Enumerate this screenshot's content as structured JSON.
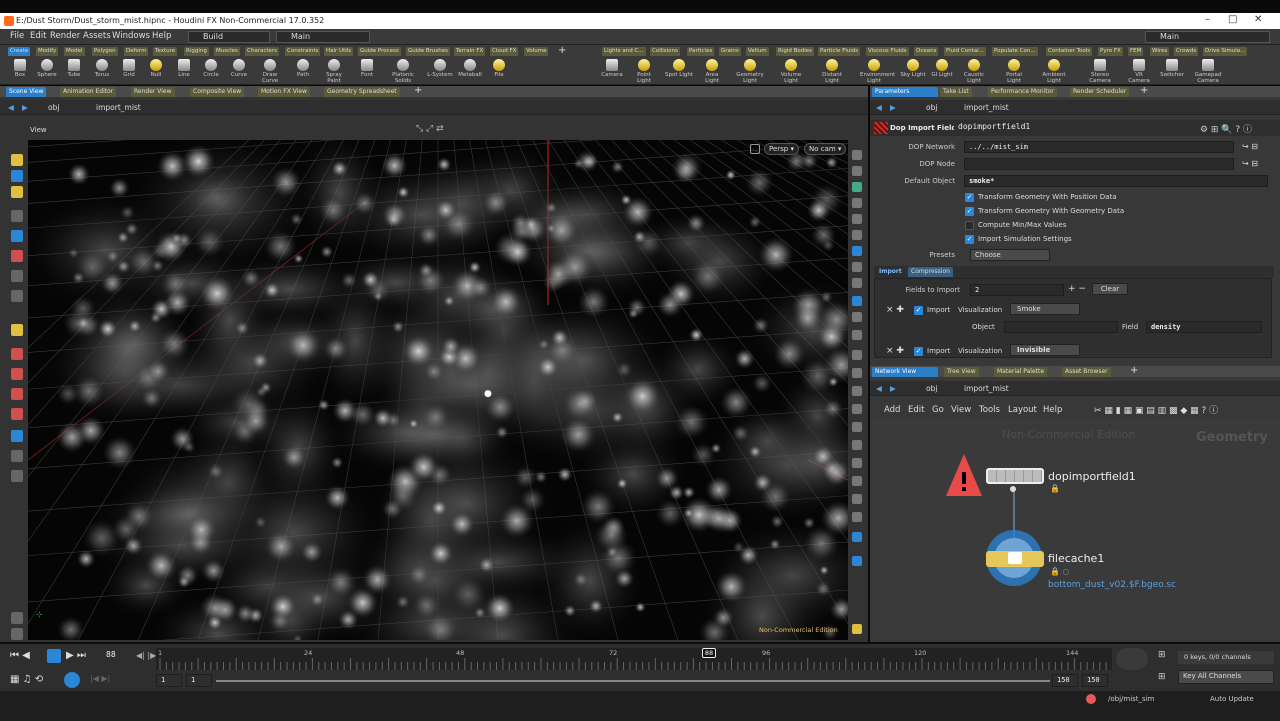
{
  "window": {
    "title": "E:/Dust Storm/Dust_storm_mist.hipnc - Houdini FX Non-Commercial 17.0.352"
  },
  "menu": [
    "File",
    "Edit",
    "Render",
    "Assets",
    "Windows",
    "Help"
  ],
  "desktops": {
    "build": "Build",
    "main": "Main",
    "right_main": "Main"
  },
  "shelf_tabs_left": [
    "Create",
    "Modify",
    "Model",
    "Polygon",
    "Deform",
    "Texture",
    "Rigging",
    "Muscles",
    "Characters",
    "Constraints",
    "Hair Utils",
    "Guide Process",
    "Guide Brushes",
    "Terrain FX",
    "Cloud FX",
    "Volume"
  ],
  "shelf_tabs_right": [
    "Lights and C...",
    "Collisions",
    "Particles",
    "Grains",
    "Vellum",
    "Rigid Bodies",
    "Particle Fluids",
    "Viscous Fluids",
    "Oceans",
    "Fluid Contai...",
    "Populate Con...",
    "Container Tools",
    "Pyro FX",
    "FEM",
    "Wires",
    "Crowds",
    "Drive Simula..."
  ],
  "tools_left": [
    "Box",
    "Sphere",
    "Tube",
    "Torus",
    "Grid",
    "Null",
    "Line",
    "Circle",
    "Curve",
    "Draw Curve",
    "Path",
    "Spray Paint",
    "Font",
    "Platonic Solids",
    "L-System",
    "Metaball",
    "File"
  ],
  "tools_right": [
    "Camera",
    "Point Light",
    "Spot Light",
    "Area Light",
    "Geometry Light",
    "Volume Light",
    "Distant Light",
    "Environment Light",
    "Sky Light",
    "GI Light",
    "Caustic Light",
    "Portal Light",
    "Ambient Light",
    "Stereo Camera",
    "VR Camera",
    "Switcher",
    "Gamepad Camera"
  ],
  "left_pane": {
    "tabs": [
      "Scene View",
      "Animation Editor",
      "Render View",
      "Composite View",
      "Motion FX View",
      "Geometry Spreadsheet"
    ],
    "path": {
      "obj": "obj",
      "node": "import_mist"
    },
    "view_label": "View",
    "persp": "Persp",
    "cam": "No cam",
    "watermark": "Non-Commercial Edition"
  },
  "right_pane": {
    "tabs": [
      "Parameters",
      "Take List",
      "Performance Monitor",
      "Render Scheduler"
    ],
    "path": {
      "obj": "obj",
      "node": "import_mist"
    },
    "node_type": "Dop Import Fields",
    "node_name": "dopimportfield1",
    "params": {
      "dop_network_label": "DOP Network",
      "dop_network": "../../mist_sim",
      "dop_node_label": "DOP Node",
      "dop_node": "",
      "default_object_label": "Default Object",
      "default_object": "smoke*",
      "checks": [
        {
          "label": "Transform Geometry With Position Data",
          "on": true
        },
        {
          "label": "Transform Geometry With Geometry Data",
          "on": true
        },
        {
          "label": "Compute Min/Max Values",
          "on": false
        },
        {
          "label": "Import Simulation Settings",
          "on": true
        }
      ],
      "presets_label": "Presets",
      "presets": "Choose",
      "subtabs": [
        "Import",
        "Compression"
      ],
      "fields_label": "Fields to Import",
      "fields_count": "2",
      "clear": "Clear",
      "row1": {
        "import": "Import",
        "vis_label": "Visualization",
        "vis": "Smoke",
        "object_label": "Object",
        "field_label": "Field",
        "field": "density"
      },
      "row2": {
        "import": "Import",
        "vis_label": "Visualization",
        "vis": "Invisible"
      }
    }
  },
  "network": {
    "tabs": [
      "Network View",
      "Tree View",
      "Material Palette",
      "Asset Browser"
    ],
    "path": {
      "obj": "obj",
      "node": "import_mist"
    },
    "menu": [
      "Add",
      "Edit",
      "Go",
      "View",
      "Tools",
      "Layout",
      "Help"
    ],
    "watermark": "Non-Commercial Edition",
    "context": "Geometry",
    "node1": "dopimportfield1",
    "node2": "filecache1",
    "node2_file": "bottom_dust_v02.$F.bgeo.sc"
  },
  "timeline": {
    "frame": "88",
    "ticks": [
      "1",
      "24",
      "48",
      "72",
      "96",
      "120",
      "144"
    ],
    "current_marker": "88",
    "start": "1",
    "start2": "1",
    "end": "150",
    "end2": "150",
    "keys": "0 keys, 0/0 channels",
    "key_all": "Key All Channels",
    "status_path": "/obj/mist_sim",
    "auto_update": "Auto Update"
  },
  "colors": {
    "accent": "#2a86d6",
    "tab": "#5b5b3a",
    "warn": "#e84a4a",
    "cache": "#e6c85a"
  }
}
